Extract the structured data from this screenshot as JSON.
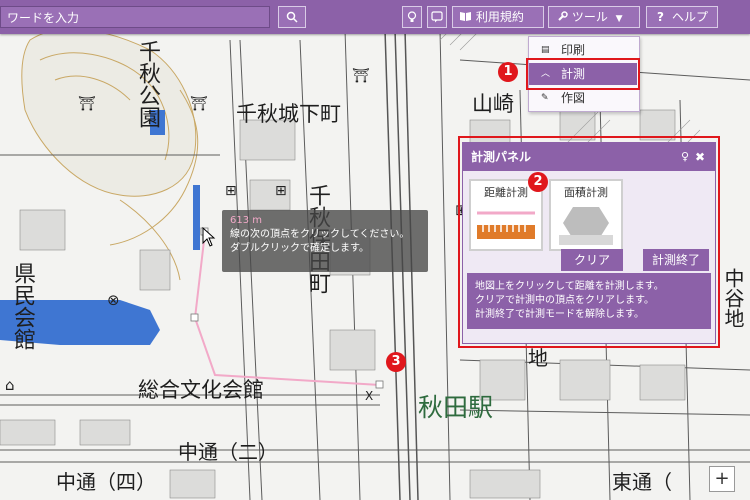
{
  "toolbar": {
    "search_placeholder": "ワードを入力",
    "terms_label": "利用規約",
    "tools_label": "ツール",
    "help_label": "ヘルプ",
    "help_mark": "?"
  },
  "tools_menu": {
    "items": [
      {
        "label": "印刷"
      },
      {
        "label": "計測",
        "selected": true
      },
      {
        "label": "作図"
      }
    ]
  },
  "badges": [
    "1",
    "2",
    "3"
  ],
  "panel": {
    "title": "計測パネル",
    "distance_label": "距離計測",
    "area_label": "面積計測",
    "clear_label": "クリア",
    "end_label": "計測終了",
    "help_lines": [
      "地図上をクリックして距離を計測します。",
      "クリアで計測中の頂点をクリアします。",
      "計測終了で計測モードを解除します。"
    ]
  },
  "tooltip": {
    "distance": "613 m",
    "line1": "線の次の頂点をクリックしてください。",
    "line2": "ダブルクリックで確定します。"
  },
  "map_labels": {
    "senshu_park": "千秋公園",
    "senshu_jokamachi": "千秋城下町",
    "senshu_hodamachi": "千秋保田町",
    "yamazaki": "山崎",
    "prefectural_hall": "県民会館",
    "culture_hall": "総合文化会館",
    "akita_station": "秋田駅",
    "nakadori_2": "中通（二）",
    "nakadori_4": "中通（四）",
    "higashidori": "東通（",
    "nakaya": "中谷地",
    "chi": "地",
    "sen": "千"
  },
  "zoom_in": "+",
  "colors": {
    "toolbar": "#8c61a8",
    "highlight": "#e0171c",
    "water": "#3f76d2",
    "station_text": "#2e6b3e",
    "measure_line": "#f2a9c8"
  }
}
